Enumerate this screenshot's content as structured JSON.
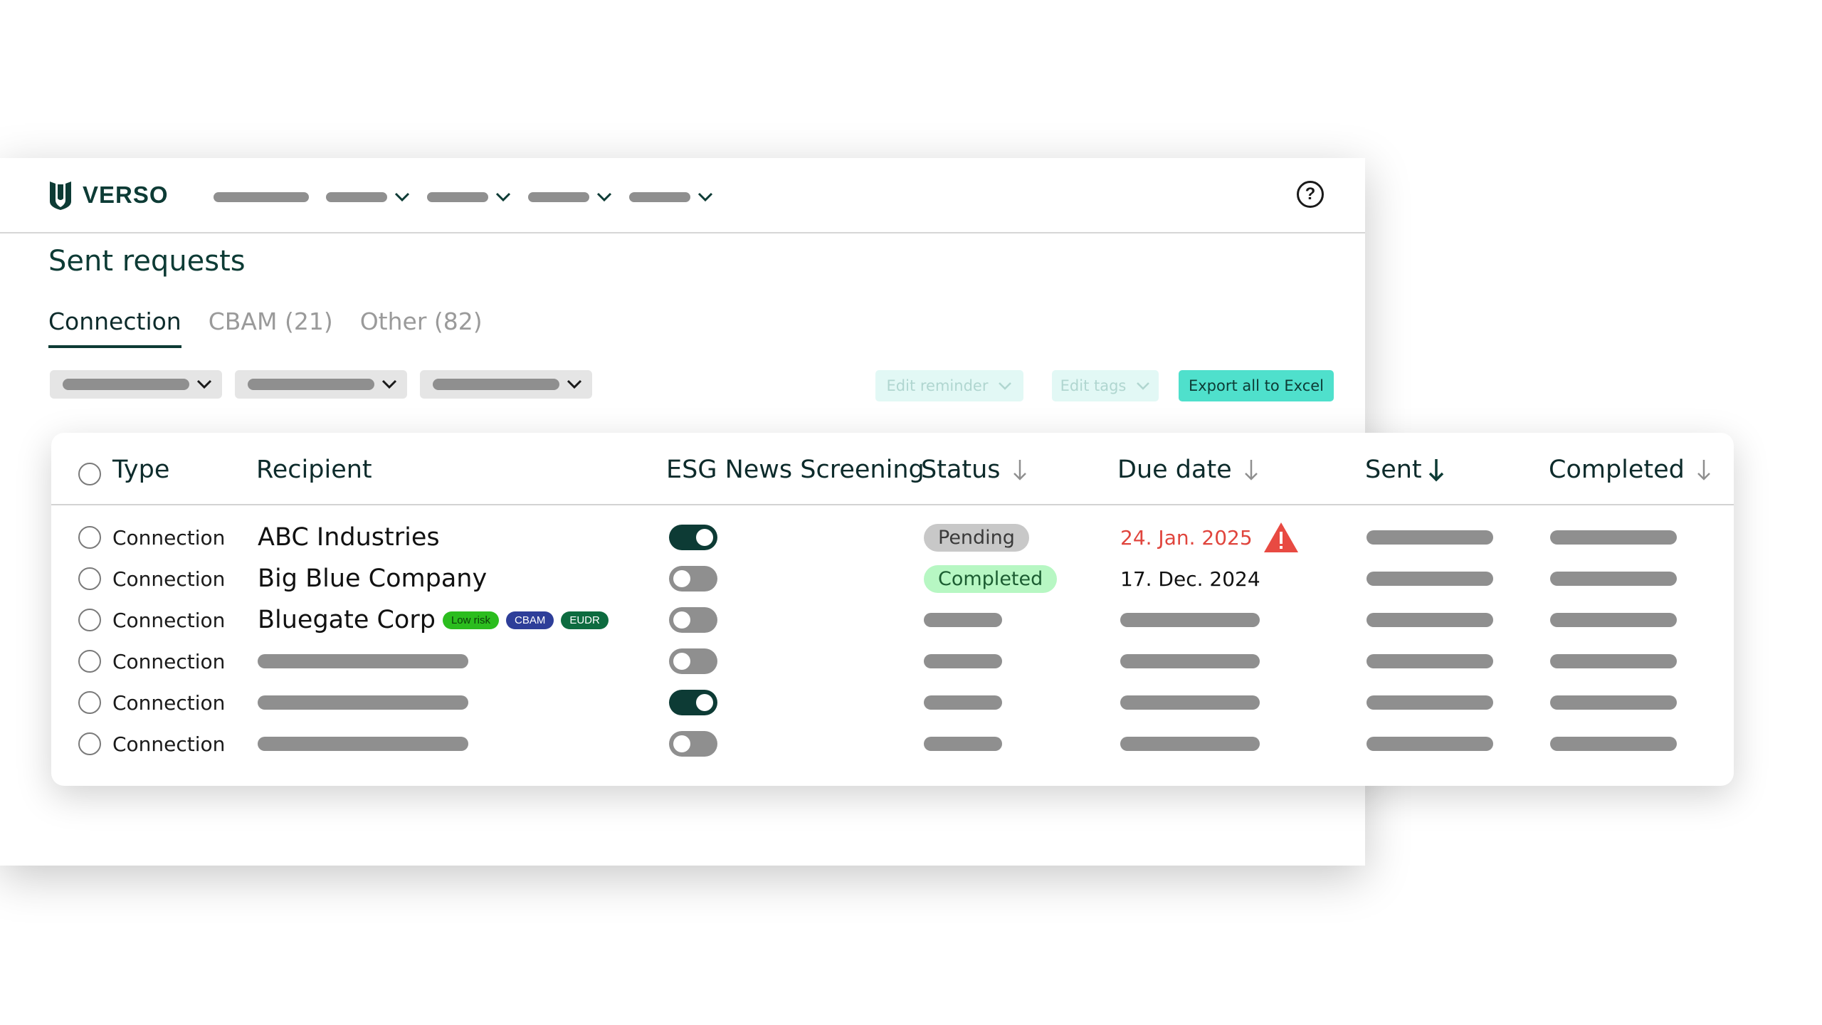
{
  "brand": {
    "name": "VERSO",
    "primary": "#0d3b35",
    "accent": "#4fe0cc"
  },
  "nav": {
    "help_label": "?",
    "items": [
      {
        "placeholder_width": 134,
        "has_dropdown": false
      },
      {
        "placeholder_width": 86,
        "has_dropdown": true
      },
      {
        "placeholder_width": 86,
        "has_dropdown": true
      },
      {
        "placeholder_width": 86,
        "has_dropdown": true
      },
      {
        "placeholder_width": 86,
        "has_dropdown": true
      }
    ]
  },
  "page": {
    "title": "Sent requests"
  },
  "tabs": [
    {
      "label": "Connection",
      "active": true
    },
    {
      "label": "CBAM (21)",
      "active": false
    },
    {
      "label": "Other (82)",
      "active": false
    }
  ],
  "toolbar": {
    "edit_reminder": "Edit reminder",
    "edit_tags": "Edit tags",
    "export": "Export all to Excel"
  },
  "table": {
    "columns": {
      "type": "Type",
      "recipient": "Recipient",
      "esg": "ESG News Screening",
      "status": "Status",
      "due": "Due date",
      "sent": "Sent",
      "completed": "Completed"
    },
    "rows": [
      {
        "type": "Connection",
        "recipient": "ABC Industries",
        "tags": [],
        "esg_on": true,
        "status": "Pending",
        "status_kind": "pending",
        "due": "24. Jan. 2025",
        "overdue": true
      },
      {
        "type": "Connection",
        "recipient": "Big Blue Company",
        "tags": [],
        "esg_on": false,
        "status": "Completed",
        "status_kind": "completed",
        "due": "17. Dec. 2024",
        "overdue": false
      },
      {
        "type": "Connection",
        "recipient": "Bluegate Corp",
        "tags": [
          {
            "label": "Low risk",
            "kind": "lowrisk"
          },
          {
            "label": "CBAM",
            "kind": "cbam"
          },
          {
            "label": "EUDR",
            "kind": "eudr"
          }
        ],
        "esg_on": false,
        "status": "",
        "status_kind": "",
        "due": "",
        "overdue": false
      },
      {
        "type": "Connection",
        "recipient": "",
        "tags": [],
        "esg_on": false,
        "status": "",
        "status_kind": "",
        "due": "",
        "overdue": false
      },
      {
        "type": "Connection",
        "recipient": "",
        "tags": [],
        "esg_on": true,
        "status": "",
        "status_kind": "",
        "due": "",
        "overdue": false
      },
      {
        "type": "Connection",
        "recipient": "",
        "tags": [],
        "esg_on": false,
        "status": "",
        "status_kind": "",
        "due": "",
        "overdue": false
      }
    ]
  }
}
